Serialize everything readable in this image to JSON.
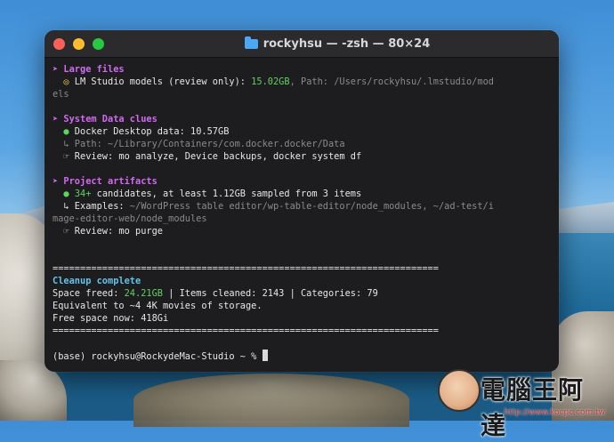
{
  "window": {
    "title": "rockyhsu — -zsh — 80×24"
  },
  "terminal": {
    "lines": [
      {
        "segments": [
          {
            "t": "➤ Large files",
            "c": "head"
          }
        ]
      },
      {
        "segments": [
          {
            "t": "  ",
            "c": ""
          },
          {
            "t": "◎",
            "c": "yellow"
          },
          {
            "t": " LM Studio models (review only): ",
            "c": ""
          },
          {
            "t": "15.02GB",
            "c": "green"
          },
          {
            "t": ", Path: /Users/rockyhsu/.lmstudio/mod",
            "c": "dim"
          }
        ]
      },
      {
        "segments": [
          {
            "t": "els",
            "c": "dim"
          }
        ]
      },
      {
        "segments": [
          {
            "t": "",
            "c": ""
          }
        ]
      },
      {
        "segments": [
          {
            "t": "➤ System Data clues",
            "c": "head"
          }
        ]
      },
      {
        "segments": [
          {
            "t": "  ",
            "c": ""
          },
          {
            "t": "●",
            "c": "green"
          },
          {
            "t": " Docker Desktop data: 10.57GB",
            "c": ""
          }
        ]
      },
      {
        "segments": [
          {
            "t": "  ↳ Path: ~/Library/Containers/com.docker.docker/Data",
            "c": "dim"
          }
        ]
      },
      {
        "segments": [
          {
            "t": "  ☞ Review: mo analyze, Device backups, docker system df",
            "c": ""
          }
        ]
      },
      {
        "segments": [
          {
            "t": "",
            "c": ""
          }
        ]
      },
      {
        "segments": [
          {
            "t": "➤ Project artifacts",
            "c": "head"
          }
        ]
      },
      {
        "segments": [
          {
            "t": "  ",
            "c": ""
          },
          {
            "t": "●",
            "c": "green"
          },
          {
            "t": " ",
            "c": ""
          },
          {
            "t": "34+",
            "c": "green"
          },
          {
            "t": " candidates, at least 1.12GB sampled from 3 items",
            "c": ""
          }
        ]
      },
      {
        "segments": [
          {
            "t": "  ↳ Examples: ",
            "c": ""
          },
          {
            "t": "~/WordPress table editor/wp-table-editor/node_modules, ~/ad-test/i",
            "c": "dim"
          }
        ]
      },
      {
        "segments": [
          {
            "t": "mage-editor-web/node_modules",
            "c": "dim"
          }
        ]
      },
      {
        "segments": [
          {
            "t": "  ☞ Review: mo purge",
            "c": ""
          }
        ]
      },
      {
        "segments": [
          {
            "t": "",
            "c": ""
          }
        ]
      },
      {
        "segments": [
          {
            "t": "",
            "c": ""
          }
        ]
      },
      {
        "segments": [
          {
            "t": "======================================================================",
            "c": ""
          }
        ]
      },
      {
        "segments": [
          {
            "t": "Cleanup complete",
            "c": "cyan"
          }
        ]
      },
      {
        "segments": [
          {
            "t": "Space freed: ",
            "c": ""
          },
          {
            "t": "24.21GB",
            "c": "green"
          },
          {
            "t": " | Items cleaned: 2143 | Categories: 79",
            "c": ""
          }
        ]
      },
      {
        "segments": [
          {
            "t": "Equivalent to ~4 4K movies of storage.",
            "c": ""
          }
        ]
      },
      {
        "segments": [
          {
            "t": "Free space now: 418Gi",
            "c": ""
          }
        ]
      },
      {
        "segments": [
          {
            "t": "======================================================================",
            "c": ""
          }
        ]
      },
      {
        "segments": [
          {
            "t": "",
            "c": ""
          }
        ]
      },
      {
        "segments": [
          {
            "t": "(base) rockyhsu@RockydeMac-Studio ~ % ",
            "c": ""
          }
        ],
        "cursor": true
      }
    ]
  },
  "watermark": {
    "text": "電腦王阿達",
    "url": "http://www.kocpc.com.tw"
  }
}
